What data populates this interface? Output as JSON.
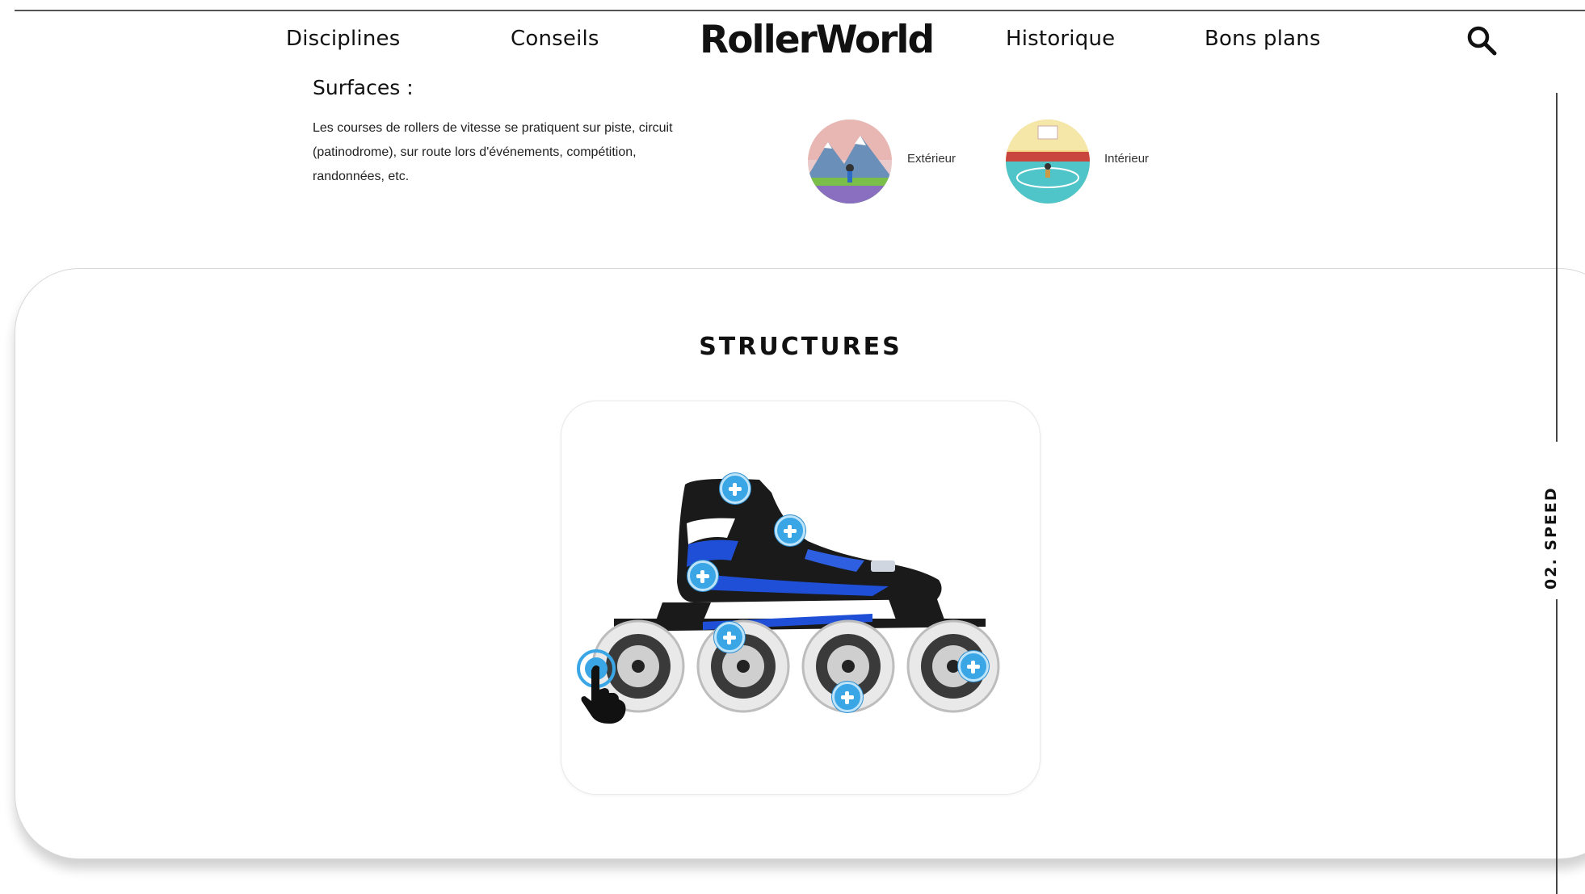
{
  "nav": {
    "left_links": [
      "Disciplines",
      "Conseils"
    ],
    "logo": "RollerWorld",
    "right_links": [
      "Historique",
      "Bons plans"
    ],
    "search_icon": "search-icon"
  },
  "surfaces": {
    "title": "Surfaces :",
    "description": "Les courses de rollers de vitesse se pratiquent sur piste, circuit (patinodrome), sur route lors d'événements, compétition, randonnées, etc.",
    "options": [
      {
        "label": "Extérieur",
        "icon": "outdoor-mountain-illustration"
      },
      {
        "label": "Intérieur",
        "icon": "indoor-rink-illustration"
      }
    ]
  },
  "structures": {
    "title": "STRUCTURES",
    "hotspot_icon": "plus-circle-icon",
    "hotspot_count": 6,
    "pointer_icon": "tap-hand-icon"
  },
  "section_indicator": {
    "label": "02. SPEED"
  },
  "colors": {
    "hotspot": "#3aa6e6",
    "skate_accent": "#1e4fd6",
    "text": "#111111"
  }
}
